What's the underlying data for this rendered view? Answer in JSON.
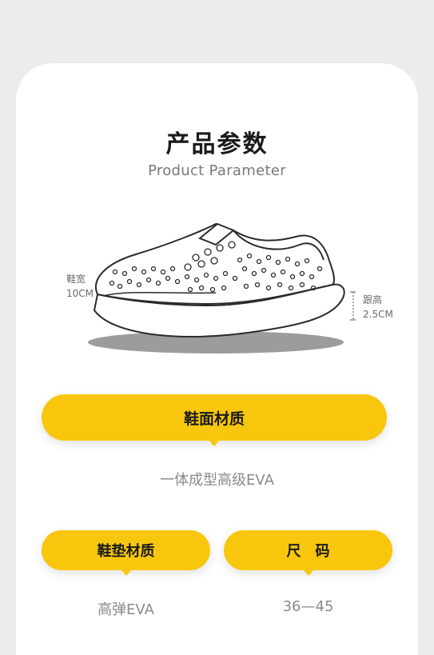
{
  "header": {
    "title_cn": "产品参数",
    "title_en": "Product Parameter"
  },
  "dimensions": {
    "width_label": "鞋宽",
    "width_value": "10CM",
    "heel_label": "跟高",
    "heel_value": "2.5CM"
  },
  "upper_material": {
    "label": "鞋面材质",
    "value": "一体成型高级EVA"
  },
  "insole_material": {
    "label": "鞋垫材质",
    "value": "高弹EVA"
  },
  "size": {
    "label": "尺　码",
    "value": "36—45"
  },
  "colors": {
    "accent": "#f8c70d",
    "background": "#ececec",
    "card": "#ffffff"
  }
}
